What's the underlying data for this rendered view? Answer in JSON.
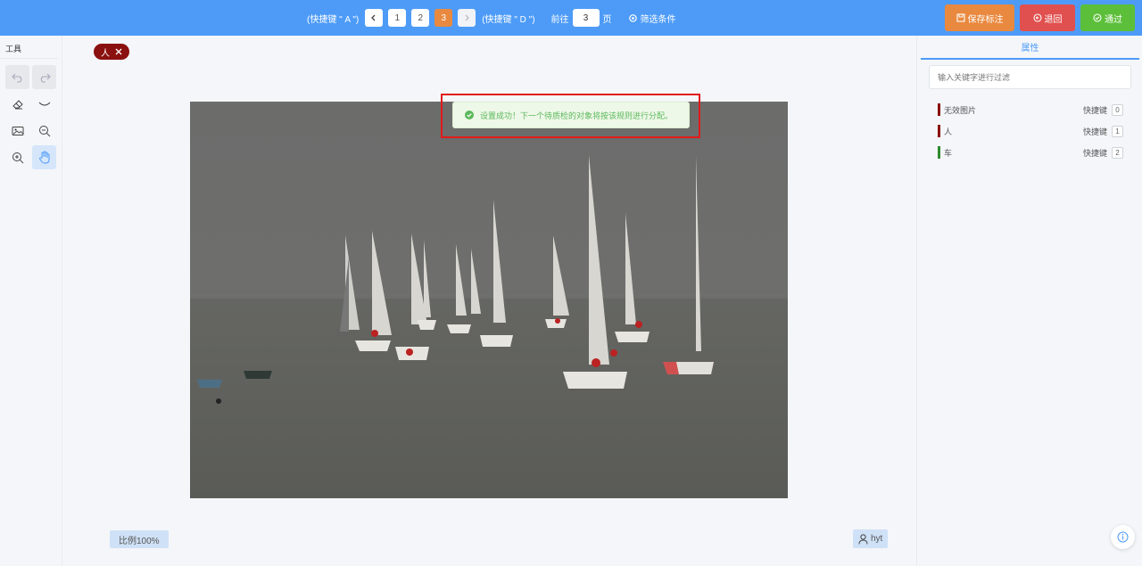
{
  "topbar": {
    "prev_hint": "(快捷键 \" A \")",
    "next_hint": "(快捷键 \" D \")",
    "pages": [
      "1",
      "2",
      "3"
    ],
    "active_page": "3",
    "goto_prefix": "前往",
    "goto_value": "3",
    "goto_suffix": "页",
    "filter_label": "筛选条件",
    "save_label": "保存标注",
    "back_label": "退回",
    "pass_label": "通过",
    "colors": {
      "bar": "#4d9bf7",
      "save": "#e9893f",
      "back": "#e0504f",
      "pass": "#5cbf3a"
    }
  },
  "tools": {
    "title": "工具",
    "items": [
      {
        "name": "undo-icon",
        "state": "disabled"
      },
      {
        "name": "redo-icon",
        "state": "disabled"
      },
      {
        "name": "eraser-icon",
        "state": "normal"
      },
      {
        "name": "eye-closed-icon",
        "state": "normal"
      },
      {
        "name": "image-icon",
        "state": "normal"
      },
      {
        "name": "zoom-out-icon",
        "state": "normal"
      },
      {
        "name": "zoom-in-icon",
        "state": "normal"
      },
      {
        "name": "hand-icon",
        "state": "active"
      }
    ]
  },
  "canvas": {
    "tag_chip": "人",
    "tag_chip_color": "#8b1010",
    "scale_label": "比例100%",
    "user_name": "hyt"
  },
  "toast": {
    "message": "设置成功！下一个待质检的对象将按该规则进行分配。",
    "color": "#5cb85c"
  },
  "rightpanel": {
    "tab_label": "属性",
    "search_placeholder": "输入关键字进行过滤",
    "shortcut_label": "快捷键",
    "attributes": [
      {
        "name": "无效图片",
        "key": "0",
        "color": "#8b1010"
      },
      {
        "name": "人",
        "key": "1",
        "color": "#8b1010"
      },
      {
        "name": "车",
        "key": "2",
        "color": "#2e8b2e"
      }
    ]
  }
}
